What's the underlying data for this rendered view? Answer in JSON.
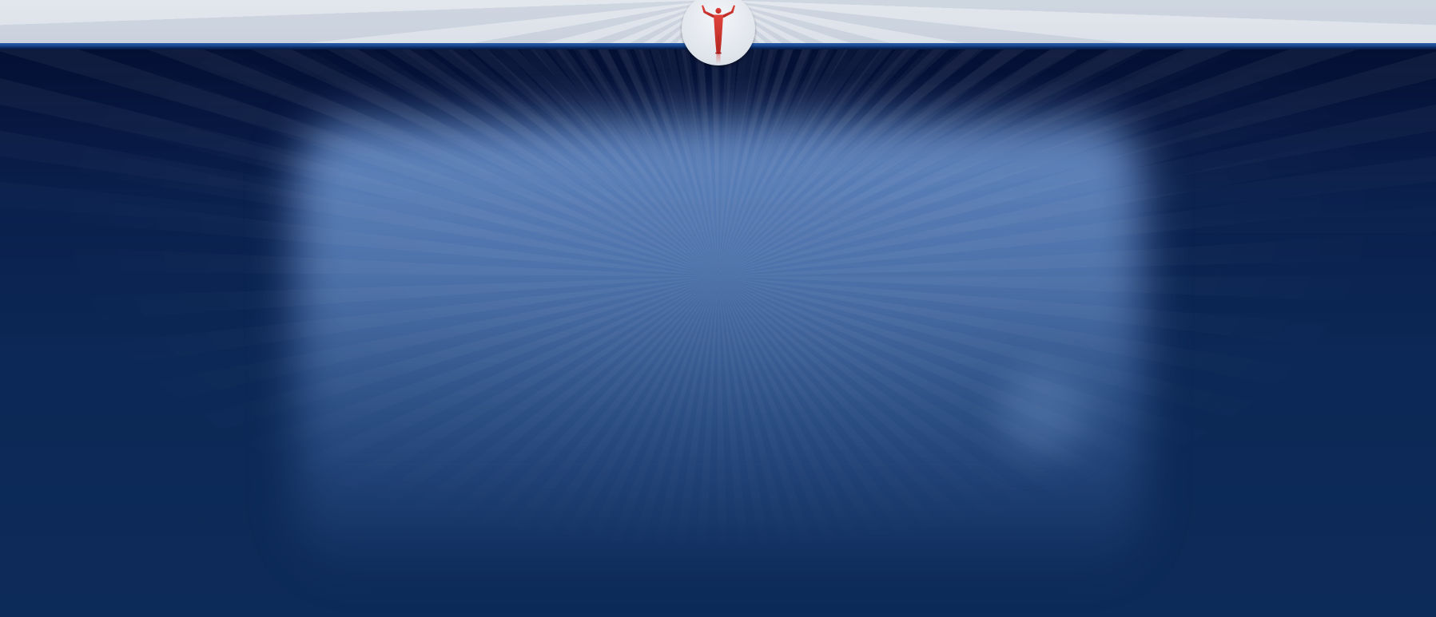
{
  "logo": {
    "icon": "person-arms-raised-icon",
    "color": "#d63a35"
  },
  "colors": {
    "header_band": "#dde2e9",
    "header_line": "#1a4a92",
    "backdrop": "#0d2a55",
    "glow": "#6e96d2"
  }
}
